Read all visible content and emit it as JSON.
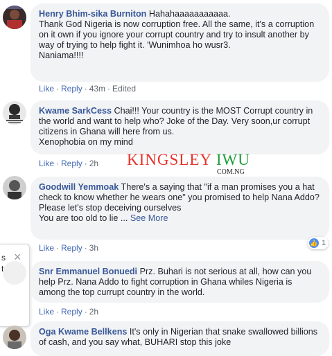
{
  "comments": [
    {
      "name": "Henry Bhim-sika Burniton",
      "line1": "Hahahaaaaaaaaaaa.",
      "text": "Thank God Nigeria is now corruption free. All the same, it's a corruption on it own if you ignore your corrupt country and try to insult another by way of trying to help fight it. 'Wunimhoa ho wusr3.",
      "text2": "Naniama!!!!",
      "like": "Like",
      "reply": "Reply",
      "time": "43m",
      "edited": "Edited"
    },
    {
      "name": "Kwame SarkCess",
      "text": "Chai!!! Your country is the MOST Corrupt country in the world and want to help who? Joke of the Day. Very soon,ur corrupt citizens in Ghana will here from us.",
      "text2": "Xenophobia on my mind",
      "like": "Like",
      "reply": "Reply",
      "time": "2h"
    },
    {
      "name": "Goodwill Yemmoak",
      "text": "There's a saying that \"if a man promises you a hat check to know whether he wears one\" you promised to help Nana Addo?",
      "text2": "Please let's stop deceiving ourselves",
      "text3": "You are too old to lie ...",
      "see_more": "See More",
      "like": "Like",
      "reply": "Reply",
      "time": "3h",
      "reaction_count": "1"
    },
    {
      "name": "Snr Emmanuel Bonuedi",
      "text": "Prz. Buhari is not serious at all, how can you help Prz. Nana Addo to fight corruption in Ghana whiles Nigeria is among the top currupt country in the world.",
      "like": "Like",
      "reply": "Reply",
      "time": "2h"
    },
    {
      "name": "Oga Kwame Bellkens",
      "text": "It's only in Nigerian that snake swallowed billions of cash, and you say what, BUHARI stop this joke"
    }
  ],
  "watermark": {
    "part1": "KINGSLEY",
    "part2": "IWU",
    "sub": "COM.NG"
  },
  "side_popup": {
    "line1": "s",
    "line2": "t",
    "close": "×"
  },
  "colors": {
    "name": "#385898",
    "link": "#4267b2",
    "bubble": "#f2f3f5",
    "watermark_red": "#e8322a",
    "watermark_green": "#1e9d3a"
  }
}
